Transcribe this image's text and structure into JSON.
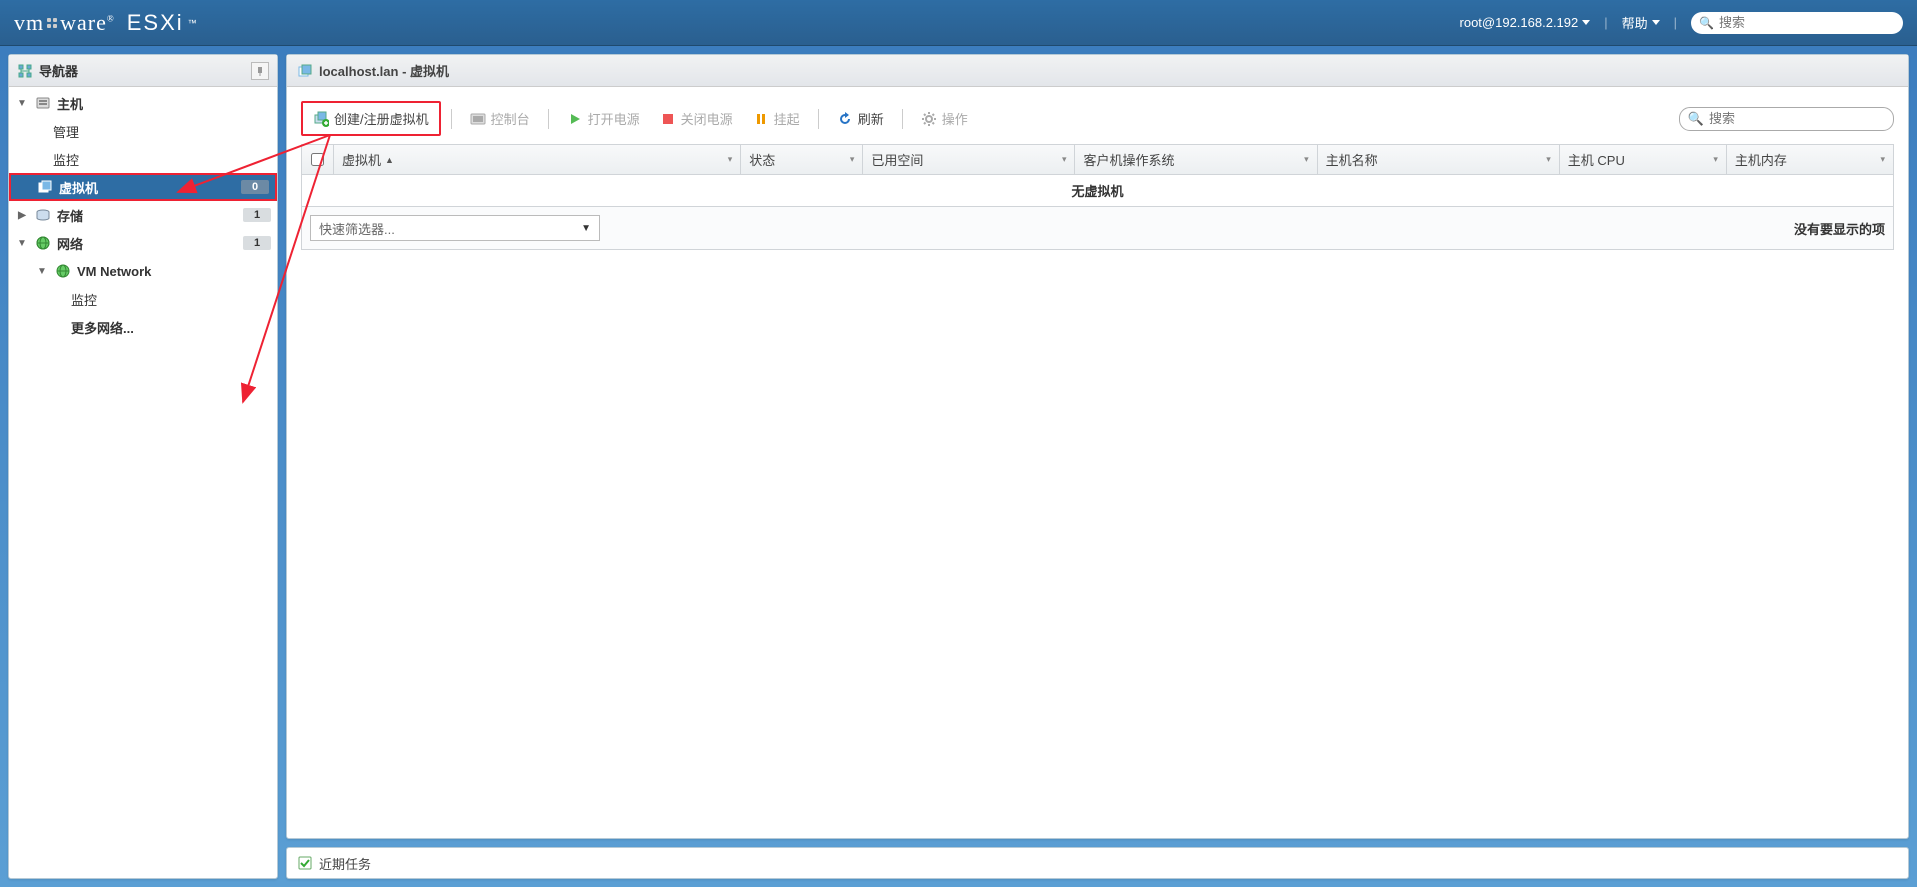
{
  "header": {
    "product": "vmware",
    "edition": "ESXi",
    "user": "root@192.168.2.192",
    "help": "帮助",
    "search_placeholder": "搜索"
  },
  "sidebar": {
    "title": "导航器",
    "host_label": "主机",
    "manage_label": "管理",
    "monitor_label": "监控",
    "vm_label": "虚拟机",
    "vm_count": "0",
    "storage_label": "存储",
    "storage_count": "1",
    "network_label": "网络",
    "network_count": "1",
    "vm_network_label": "VM Network",
    "net_monitor_label": "监控",
    "more_networks_label": "更多网络..."
  },
  "content": {
    "title": "localhost.lan - 虚拟机",
    "toolbar": {
      "create": "创建/注册虚拟机",
      "console": "控制台",
      "power_on": "打开电源",
      "power_off": "关闭电源",
      "suspend": "挂起",
      "refresh": "刷新",
      "actions": "操作",
      "search_placeholder": "搜索"
    },
    "columns": {
      "vm": "虚拟机",
      "status": "状态",
      "used_space": "已用空间",
      "guest_os": "客户机操作系统",
      "host_name": "主机名称",
      "host_cpu": "主机 CPU",
      "host_mem": "主机内存"
    },
    "empty": "无虚拟机",
    "filter_placeholder": "快速筛选器...",
    "no_items": "没有要显示的项"
  },
  "tasks": {
    "title": "近期任务"
  }
}
